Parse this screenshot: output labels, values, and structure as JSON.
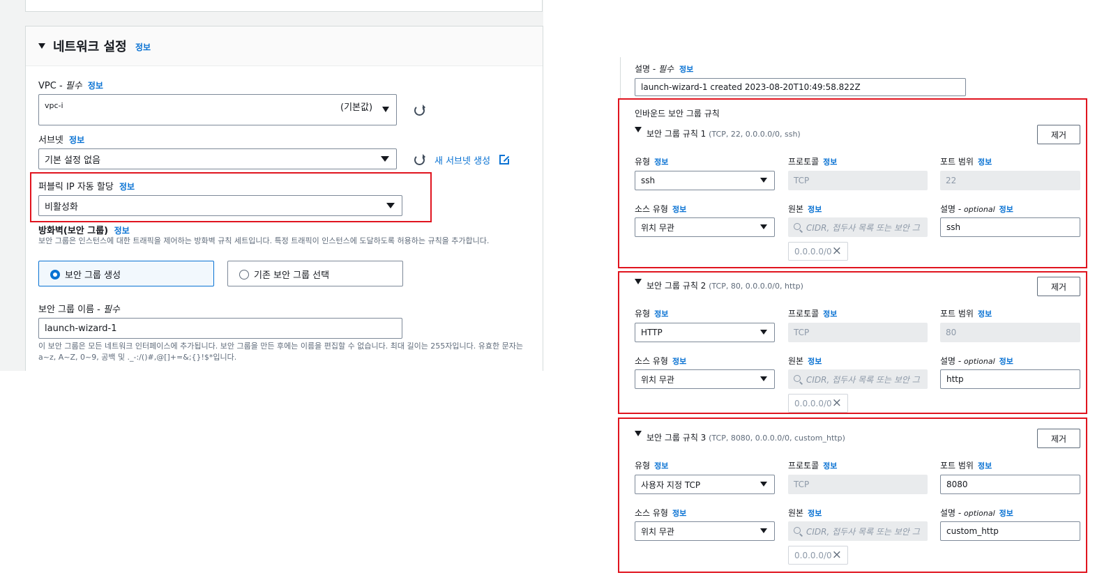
{
  "network": {
    "section_title": "네트워크 설정",
    "section_info": "정보",
    "vpc": {
      "label_prefix": "VPC - ",
      "label_required": "필수",
      "info": "정보",
      "value": "vpc-i",
      "default_tag": "(기본값)"
    },
    "subnet": {
      "label": "서브넷",
      "info": "정보",
      "value": "기본 설정 없음",
      "create_link": "새 서브넷 생성"
    },
    "public_ip": {
      "label": "퍼블릭 IP 자동 할당",
      "info": "정보",
      "value": "비활성화"
    },
    "firewall": {
      "label": "방화벽(보안 그룹)",
      "info": "정보",
      "description": "보안 그룹은 인스턴스에 대한 트래픽을 제어하는 방화벽 규칙 세트입니다. 특정 트래픽이 인스턴스에 도달하도록 허용하는 규칙을 추가합니다.",
      "option_create": "보안 그룹 생성",
      "option_existing": "기존 보안 그룹 선택"
    },
    "sg_name": {
      "label_prefix": "보안 그룹 이름 - ",
      "label_required": "필수",
      "value": "launch-wizard-1",
      "hint": "이 보안 그룹은 모든 네트워크 인터페이스에 추가됩니다. 보안 그룹을 만든 후에는 이름을 편집할 수 없습니다. 최대 길이는 255자입니다. 유효한 문자는 a~z, A~Z, 0~9, 공백 및 ._-:/()#,@[]+=&;{}!$*입니다."
    }
  },
  "right": {
    "description": {
      "label_prefix": "설명 - ",
      "label_required": "필수",
      "info": "정보",
      "value": "launch-wizard-1 created 2023-08-20T10:49:58.822Z"
    },
    "inbound_title": "인바운드 보안 그룹 규칙",
    "labels": {
      "type": "유형",
      "protocol": "프로토콜",
      "port_range": "포트 범위",
      "source_type": "소스 유형",
      "source": "원본",
      "desc": "설명 - ",
      "optional": "optional",
      "info": "정보",
      "remove": "제거",
      "source_placeholder": "CIDR, 접두사 목록 또는 보안 그"
    },
    "rules": [
      {
        "title": "보안 그룹 규칙 1",
        "summary": "(TCP, 22, 0.0.0.0/0, ssh)",
        "type": "ssh",
        "protocol": "TCP",
        "port": "22",
        "source_type": "위치 무관",
        "cidr": "0.0.0.0/0",
        "description": "ssh"
      },
      {
        "title": "보안 그룹 규칙 2",
        "summary": "(TCP, 80, 0.0.0.0/0, http)",
        "type": "HTTP",
        "protocol": "TCP",
        "port": "80",
        "source_type": "위치 무관",
        "cidr": "0.0.0.0/0",
        "description": "http"
      },
      {
        "title": "보안 그룹 규칙 3",
        "summary": "(TCP, 8080, 0.0.0.0/0, custom_http)",
        "type": "사용자 지정 TCP",
        "protocol": "TCP",
        "port": "8080",
        "source_type": "위치 무관",
        "cidr": "0.0.0.0/0",
        "description": "custom_http"
      }
    ]
  },
  "colors": {
    "accent": "#0972d3",
    "highlight_border": "#e0141e",
    "disabled_bg": "#e9ebed"
  }
}
